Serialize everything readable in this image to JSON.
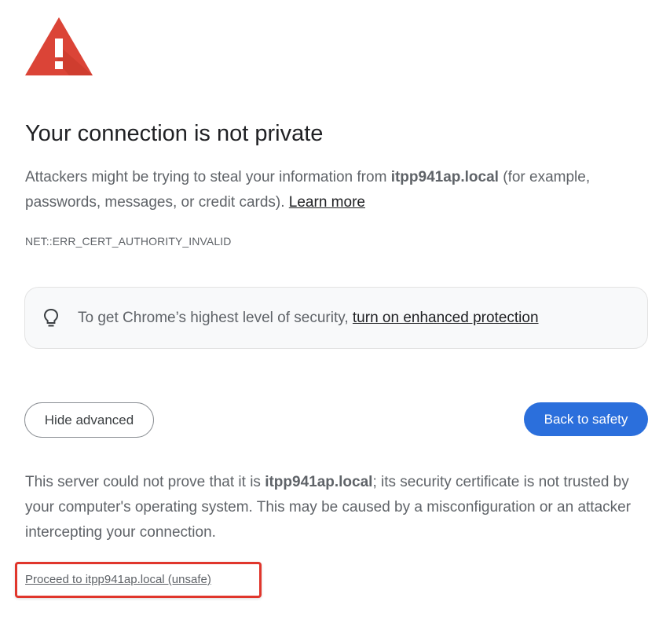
{
  "page": {
    "title": "Your connection is not private",
    "description": {
      "prefix": "Attackers might be trying to steal your information from ",
      "host": "itpp941ap.local",
      "suffix": " (for example, passwords, messages, or credit cards). ",
      "learn_more": "Learn more"
    },
    "error_code": "NET::ERR_CERT_AUTHORITY_INVALID",
    "enhanced_protection": {
      "prefix": "To get Chrome’s highest level of security, ",
      "link": "turn on enhanced protection",
      "icon": "lightbulb-icon"
    },
    "buttons": {
      "hide_advanced": "Hide advanced",
      "back_to_safety": "Back to safety"
    },
    "details": {
      "prefix": "This server could not prove that it is ",
      "host": "itpp941ap.local",
      "suffix": "; its security certificate is not trusted by your computer's operating system. This may be caused by a misconfiguration or an attacker intercepting your connection."
    },
    "proceed_link": "Proceed to itpp941ap.local (unsafe)",
    "colors": {
      "warning_red": "#db4437",
      "primary_blue": "#2b6fdc",
      "highlight_red": "#e0362c"
    }
  }
}
